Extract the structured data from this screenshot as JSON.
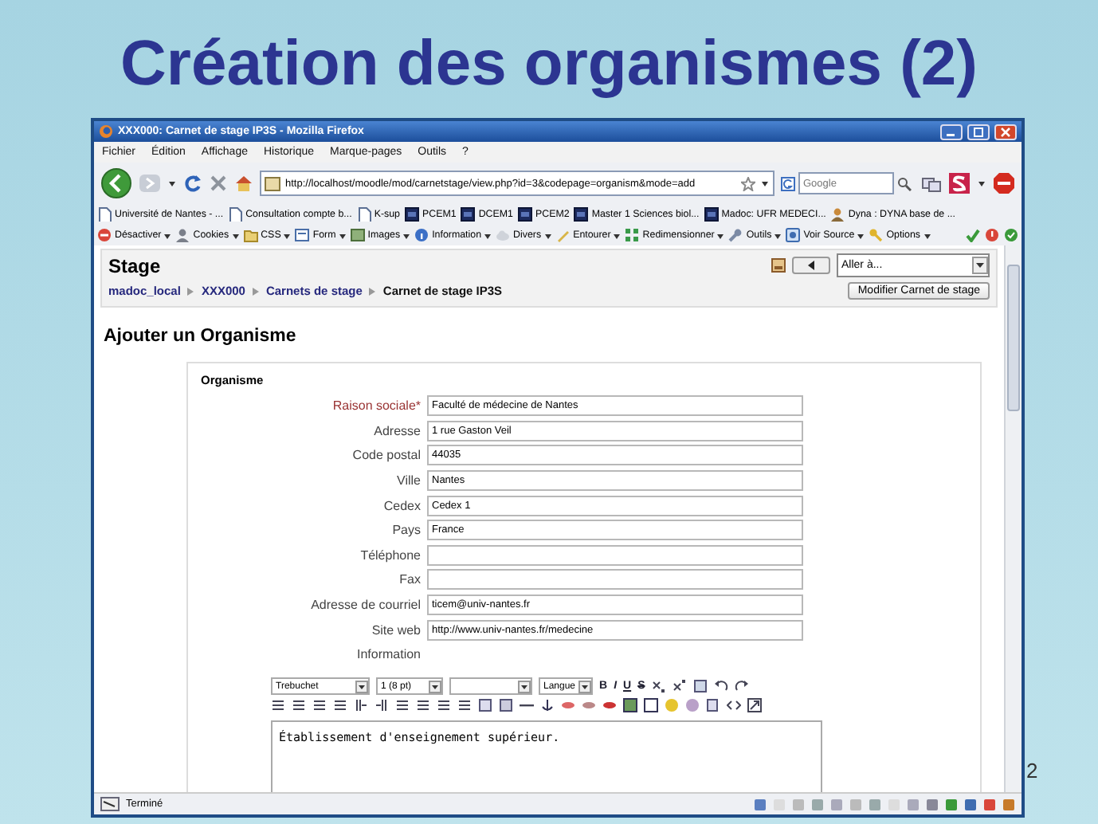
{
  "slide_title": "Création des organismes (2)",
  "slide_number": "2",
  "window": {
    "title": "XXX000: Carnet de stage IP3S - Mozilla Firefox"
  },
  "menu": [
    "Fichier",
    "Édition",
    "Affichage",
    "Historique",
    "Marque-pages",
    "Outils",
    "?"
  ],
  "nav": {
    "url": "http://localhost/moodle/mod/carnetstage/view.php?id=3&codepage=organism&mode=add",
    "search_placeholder": "Google"
  },
  "bookmarks": [
    {
      "label": "Université de Nantes - ...",
      "kind": "page"
    },
    {
      "label": "Consultation compte b...",
      "kind": "page"
    },
    {
      "label": "K-sup",
      "kind": "page"
    },
    {
      "label": "PCEM1",
      "kind": "dark"
    },
    {
      "label": "DCEM1",
      "kind": "dark"
    },
    {
      "label": "PCEM2",
      "kind": "dark"
    },
    {
      "label": "Master 1 Sciences biol...",
      "kind": "dark"
    },
    {
      "label": "Madoc: UFR MEDECI...",
      "kind": "dark"
    },
    {
      "label": "Dyna : DYNA base de ...",
      "kind": "person"
    }
  ],
  "devbar": [
    {
      "label": "Désactiver",
      "kind": "disable"
    },
    {
      "label": "Cookies",
      "kind": "cookie"
    },
    {
      "label": "CSS",
      "kind": "folder"
    },
    {
      "label": "Form",
      "kind": "form"
    },
    {
      "label": "Images",
      "kind": "image"
    },
    {
      "label": "Information",
      "kind": "info"
    },
    {
      "label": "Divers",
      "kind": "cloud"
    },
    {
      "label": "Entourer",
      "kind": "pen"
    },
    {
      "label": "Redimensionner",
      "kind": "resize"
    },
    {
      "label": "Outils",
      "kind": "wrench"
    },
    {
      "label": "Voir Source",
      "kind": "source"
    },
    {
      "label": "Options",
      "kind": "key"
    }
  ],
  "page": {
    "course_title": "Stage",
    "jump_select": "Aller à...",
    "breadcrumb": [
      {
        "label": "madoc_local",
        "link": true
      },
      {
        "label": "XXX000",
        "link": true
      },
      {
        "label": "Carnets de stage",
        "link": true
      },
      {
        "label": "Carnet de stage IP3S",
        "link": false
      }
    ],
    "edit_button": "Modifier Carnet de stage",
    "heading": "Ajouter un Organisme",
    "legend": "Organisme",
    "fields": [
      {
        "label": "Raison sociale*",
        "required": true,
        "value": "Faculté de médecine de Nantes"
      },
      {
        "label": "Adresse",
        "required": false,
        "value": "1 rue Gaston Veil"
      },
      {
        "label": "Code postal",
        "required": false,
        "value": "44035"
      },
      {
        "label": "Ville",
        "required": false,
        "value": "Nantes"
      },
      {
        "label": "Cedex",
        "required": false,
        "value": "Cedex 1"
      },
      {
        "label": "Pays",
        "required": false,
        "value": "France"
      },
      {
        "label": "Téléphone",
        "required": false
      },
      {
        "label": "Fax",
        "required": false
      },
      {
        "label": "Adresse de courriel",
        "required": false,
        "value": "ticem@univ-nantes.fr"
      },
      {
        "label": "Site web",
        "required": false,
        "value": "http://www.univ-nantes.fr/medecine"
      }
    ],
    "information_label": "Information",
    "editor": {
      "selects": [
        {
          "kind": "value",
          "label": "Trebuchet"
        },
        {
          "kind": "value",
          "label": "1 (8 pt)"
        },
        {
          "kind": "blank"
        },
        {
          "kind": "value",
          "label": "Langue"
        }
      ],
      "format_buttons": [
        "B",
        "I",
        "U",
        "S"
      ],
      "content": "Établissement d'enseignement supérieur."
    }
  },
  "status_bar": {
    "text": "Terminé"
  }
}
